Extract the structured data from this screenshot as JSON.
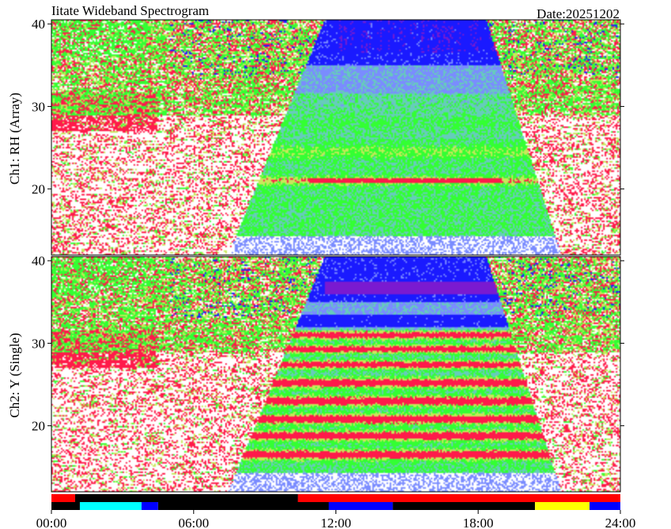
{
  "header": {
    "title": "Iitate Wideband Spectrogram",
    "date": "Date:20251202"
  },
  "chart_data": {
    "type": "heatmap",
    "title": "Iitate Wideband Spectrogram",
    "date_label": "Date:20251202",
    "x_axis": {
      "range": [
        "00:00",
        "24:00"
      ],
      "tick_labels": [
        "00:00",
        "06:00",
        "12:00",
        "18:00",
        "24:00"
      ],
      "tick_hours": [
        0,
        6,
        12,
        18,
        24
      ]
    },
    "panels": [
      {
        "ylabel": "Ch1: RH (Array)",
        "ylim": [
          12,
          40.5
        ],
        "y_ticks": [
          20,
          30,
          40
        ],
        "y_tick_labels": [
          "20",
          "30",
          "40"
        ]
      },
      {
        "ylabel": "Ch2: Y (Single)",
        "ylim": [
          12,
          40.5
        ],
        "y_ticks": [
          20,
          30,
          40
        ],
        "y_tick_labels": [
          "20",
          "30",
          "40"
        ]
      }
    ],
    "palette": [
      "#ffffff",
      "#ff1a4a",
      "#c8e85a",
      "#33ff33",
      "#66ccbb",
      "#7a8cff",
      "#1a1aff",
      "#7a1ad0"
    ],
    "status_bar": {
      "rows": [
        [
          {
            "start": 0.0,
            "end": 1.0,
            "color": "#ff0000"
          },
          {
            "start": 1.0,
            "end": 10.4,
            "color": "#000000"
          },
          {
            "start": 10.4,
            "end": 24.0,
            "color": "#ff0000"
          }
        ],
        [
          {
            "start": 0.0,
            "end": 1.2,
            "color": "#000000"
          },
          {
            "start": 1.2,
            "end": 3.8,
            "color": "#00ffff"
          },
          {
            "start": 3.8,
            "end": 4.5,
            "color": "#0000ff"
          },
          {
            "start": 4.5,
            "end": 11.7,
            "color": "#000000"
          },
          {
            "start": 11.7,
            "end": 14.4,
            "color": "#0000ff"
          },
          {
            "start": 14.4,
            "end": 20.4,
            "color": "#000000"
          },
          {
            "start": 20.4,
            "end": 22.7,
            "color": "#ffff00"
          },
          {
            "start": 22.7,
            "end": 24.0,
            "color": "#0000ff"
          }
        ]
      ]
    }
  }
}
